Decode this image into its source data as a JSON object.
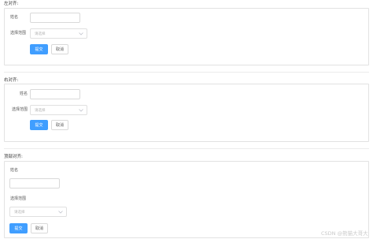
{
  "sections": [
    {
      "heading": "左对齐:",
      "name_label": "姓名",
      "select_label": "选择范围",
      "select_placeholder": "请选择",
      "submit_label": "提交",
      "cancel_label": "取消"
    },
    {
      "heading": "右对齐:",
      "name_label": "姓名",
      "select_label": "选择范围",
      "select_placeholder": "请选择",
      "submit_label": "提交",
      "cancel_label": "取消"
    },
    {
      "heading": "顶部对齐:",
      "name_label": "姓名",
      "select_label": "选择范围",
      "select_placeholder": "请选择",
      "submit_label": "提交",
      "cancel_label": "取消"
    }
  ],
  "watermark": "CSDN @熊猫大哥大",
  "colors": {
    "primary": "#409eff",
    "border": "#e2e2e2",
    "placeholder": "#b4b4b4"
  },
  "icons": {
    "select_arrow": "chevron-down-icon"
  }
}
